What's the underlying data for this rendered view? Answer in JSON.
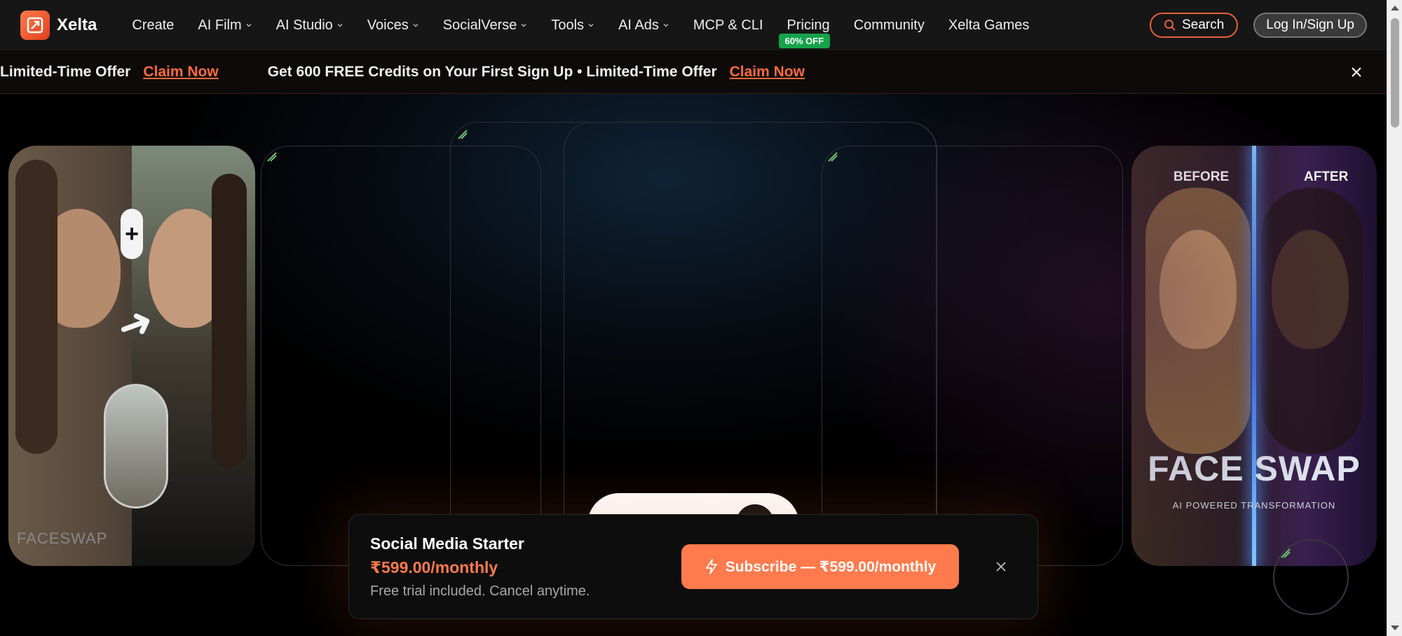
{
  "brand": {
    "name": "Xelta",
    "accent": "#ff7a4c",
    "badge_color": "#16a34a"
  },
  "nav": {
    "items": [
      {
        "label": "Create",
        "dropdown": false
      },
      {
        "label": "AI Film",
        "dropdown": true
      },
      {
        "label": "AI Studio",
        "dropdown": true
      },
      {
        "label": "Voices",
        "dropdown": true
      },
      {
        "label": "SocialVerse",
        "dropdown": true
      },
      {
        "label": "Tools",
        "dropdown": true
      },
      {
        "label": "AI Ads",
        "dropdown": true
      },
      {
        "label": "MCP & CLI",
        "dropdown": false
      },
      {
        "label": "Pricing",
        "dropdown": false
      },
      {
        "label": "Community",
        "dropdown": false
      },
      {
        "label": "Xelta Games",
        "dropdown": false
      }
    ],
    "pricing_badge": "60% OFF",
    "search_label": "Search",
    "login_label": "Log In/Sign Up"
  },
  "banner": {
    "segments": [
      {
        "text": "Limited-Time Offer",
        "claim": "Claim Now"
      },
      {
        "text": "Get 600 FREE Credits on Your First Sign Up • Limited-Time Offer",
        "claim": "Claim Now"
      }
    ]
  },
  "hero": {
    "left_card": {
      "caption": "FACESWAP"
    },
    "right_card": {
      "before_label": "BEFORE",
      "after_label": "AFTER",
      "title": "FACE SWAP",
      "subtitle": "AI POWERED TRANSFORMATION"
    }
  },
  "popup": {
    "plan_name": "Social Media Starter",
    "price": "₹599.00/monthly",
    "note": "Free trial included. Cancel anytime.",
    "cta": "Subscribe — ₹599.00/monthly"
  }
}
